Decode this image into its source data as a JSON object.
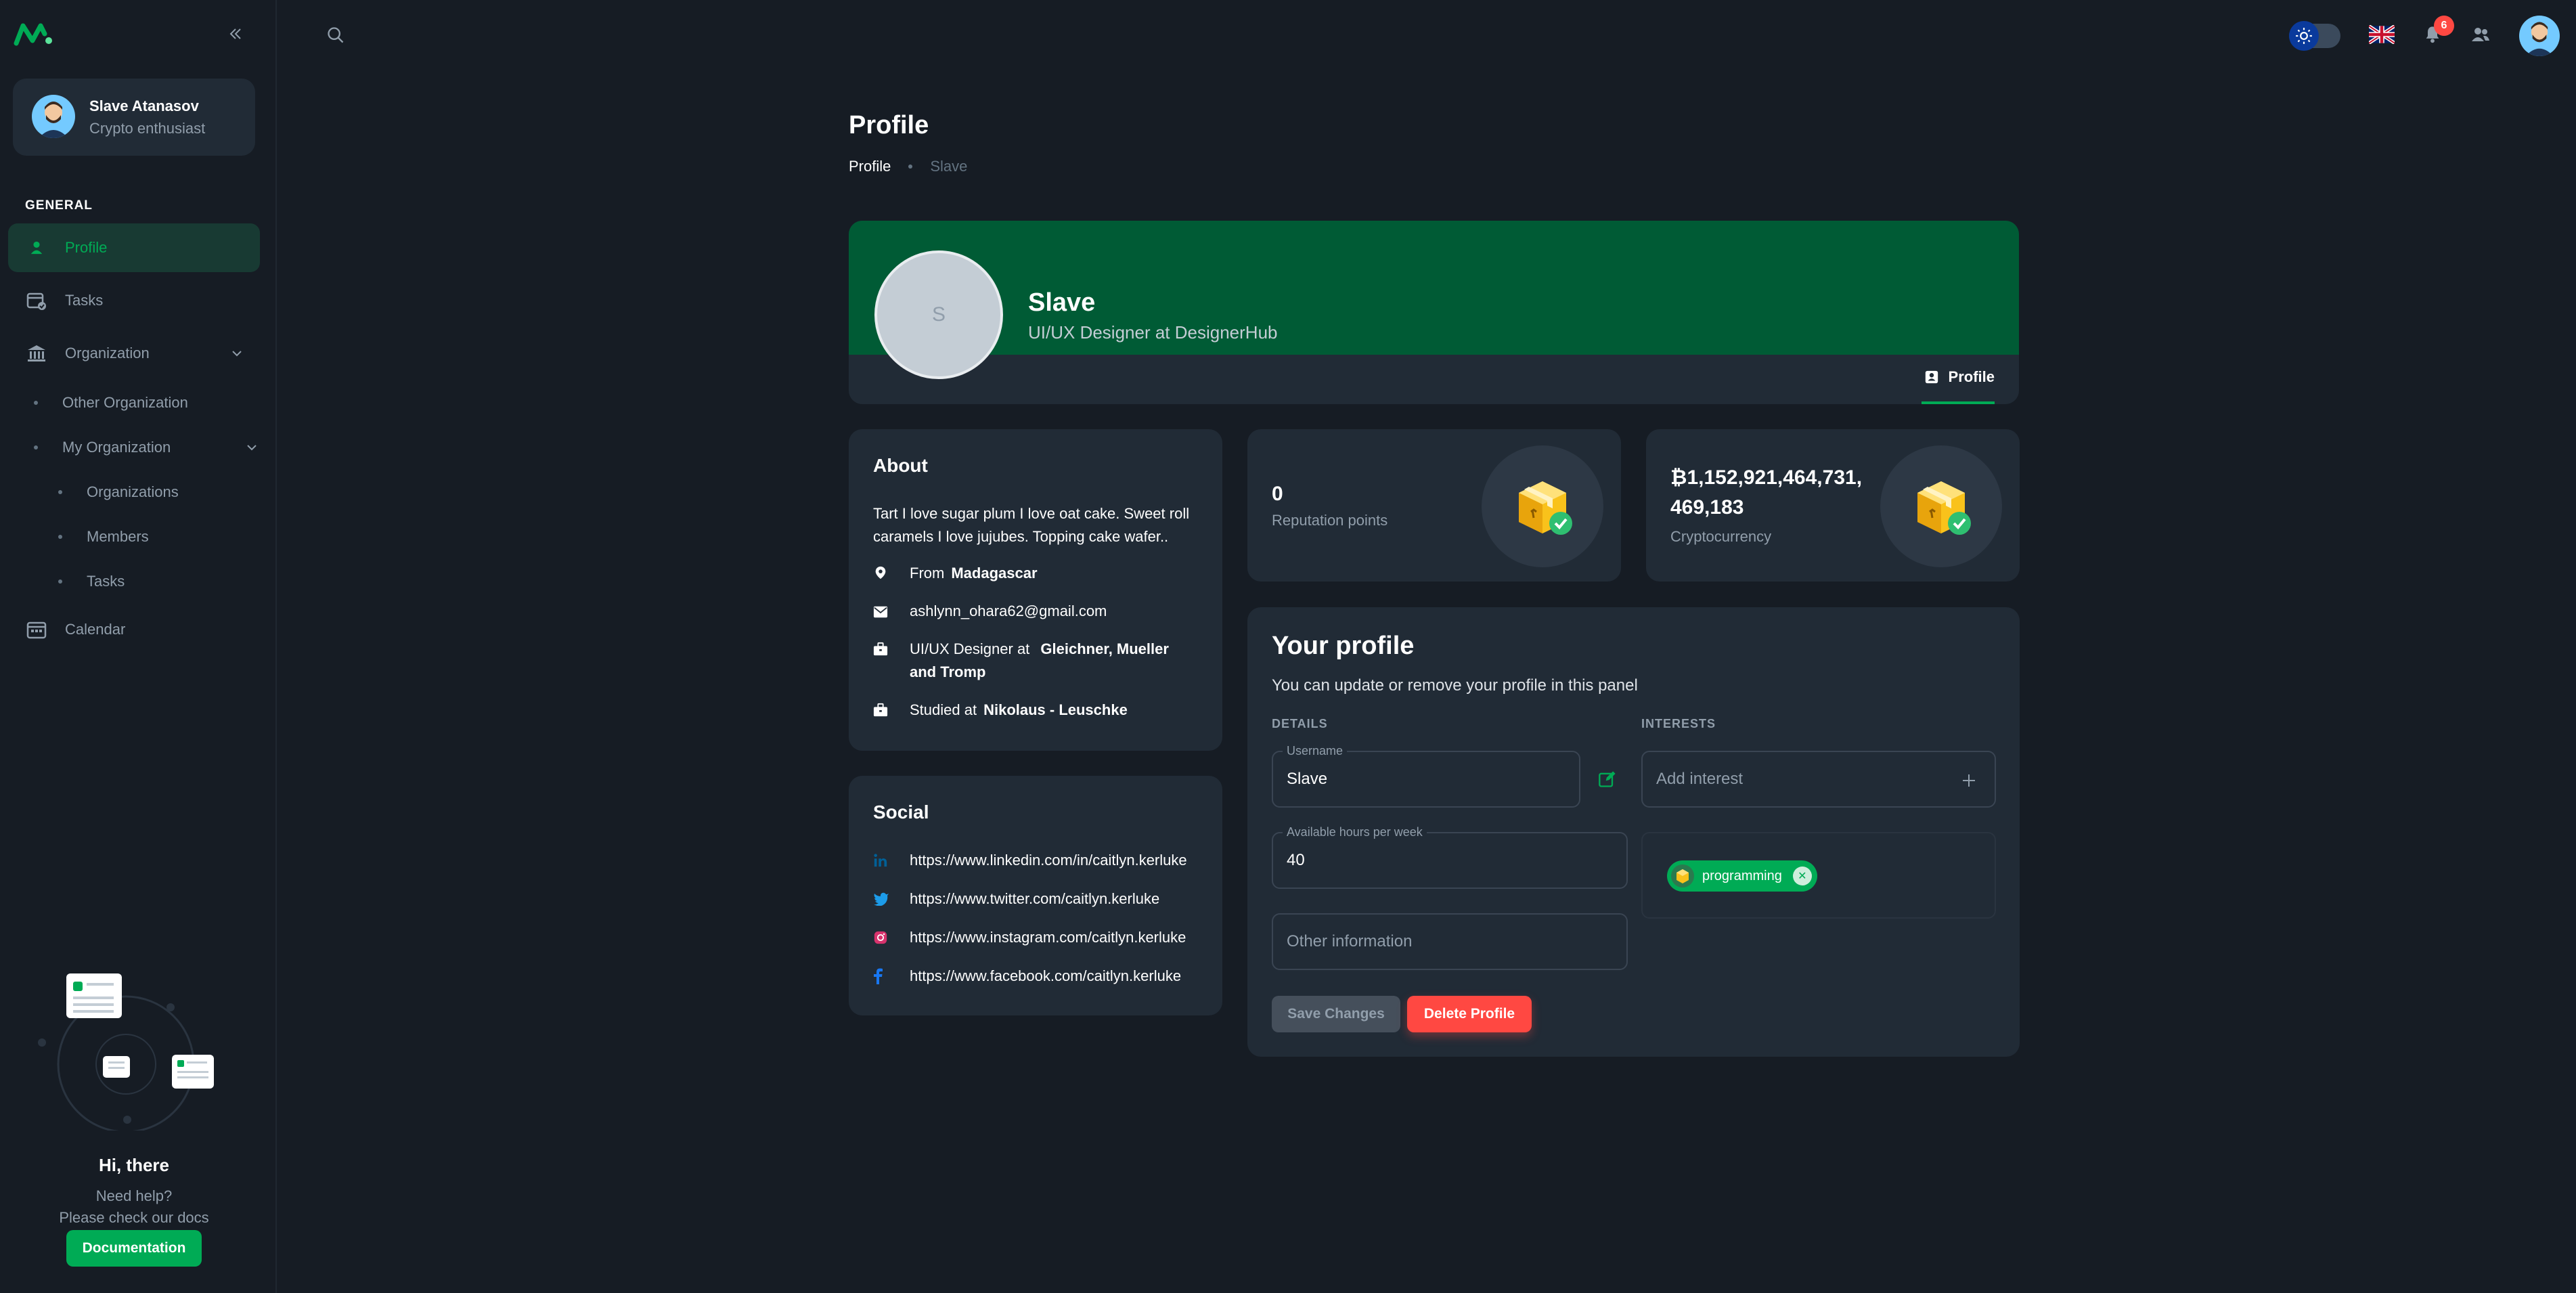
{
  "colors": {
    "accent": "#00ab55",
    "danger": "#ff4842",
    "background": "#161c24",
    "card": "#212b36",
    "cover": "#005b35"
  },
  "user": {
    "name": "Slave Atanasov",
    "role": "Crypto enthusiast"
  },
  "nav": {
    "section": "GENERAL",
    "profile": "Profile",
    "tasks": "Tasks",
    "organization": "Organization",
    "other_org": "Other Organization",
    "my_org": "My Organization",
    "organizations": "Organizations",
    "members": "Members",
    "sub_tasks": "Tasks",
    "calendar": "Calendar"
  },
  "help": {
    "title": "Hi, there",
    "line1": "Need help?",
    "line2": "Please check our docs",
    "button": "Documentation"
  },
  "topbar": {
    "notifications": "6"
  },
  "page": {
    "title": "Profile",
    "breadcrumb": [
      "Profile",
      "Slave"
    ]
  },
  "cover": {
    "initial": "S",
    "name": "Slave",
    "job": "UI/UX Designer at DesignerHub",
    "tab": "Profile"
  },
  "about": {
    "title": "About",
    "text": "Tart I love sugar plum I love oat cake. Sweet roll caramels I love jujubes. Topping cake wafer..",
    "from_label": "From",
    "from_value": "Madagascar",
    "email": "ashlynn_ohara62@gmail.com",
    "work_label": "UI/UX Designer at",
    "work_value": "Gleichner, Mueller and Tromp",
    "study_label": "Studied at",
    "study_value": "Nikolaus - Leuschke"
  },
  "social": {
    "title": "Social",
    "linkedin": "https://www.linkedin.com/in/caitlyn.kerluke",
    "twitter": "https://www.twitter.com/caitlyn.kerluke",
    "instagram": "https://www.instagram.com/caitlyn.kerluke",
    "facebook": "https://www.facebook.com/caitlyn.kerluke"
  },
  "stats": {
    "reputation_value": "0",
    "reputation_label": "Reputation points",
    "crypto_value_line1": "₿1,152,921,464,731,",
    "crypto_value_line2": "469,183",
    "crypto_label": "Cryptocurrency"
  },
  "your_profile": {
    "title": "Your profile",
    "subtitle": "You can update or remove your profile in this panel",
    "details": "DETAILS",
    "interests": "INTERESTS",
    "username_label": "Username",
    "username_value": "Slave",
    "hours_label": "Available hours per week",
    "hours_value": "40",
    "other_placeholder": "Other information",
    "interest_placeholder": "Add interest",
    "chip": "programming",
    "save": "Save Changes",
    "delete": "Delete Profile"
  }
}
